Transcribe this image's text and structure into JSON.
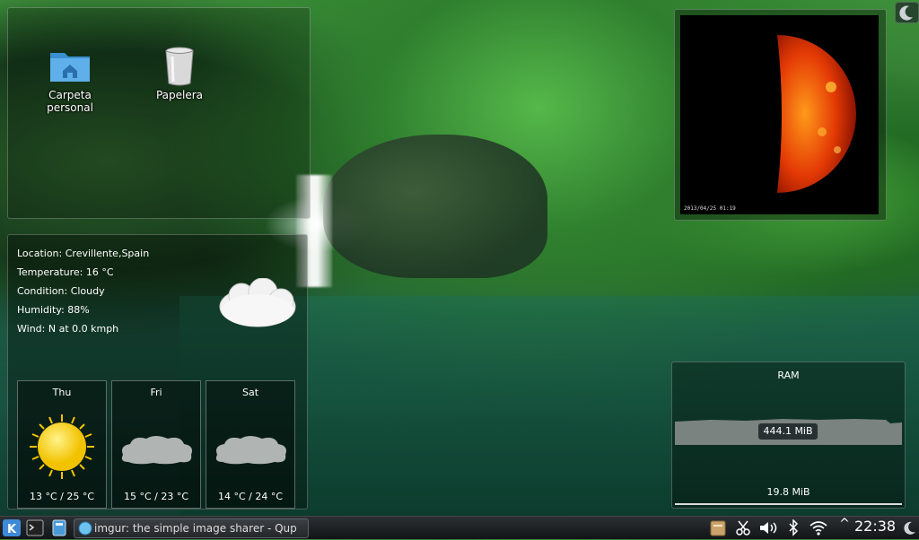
{
  "desktop": {
    "icons": [
      {
        "name": "home-folder",
        "label_line1": "Carpeta",
        "label_line2": "personal"
      },
      {
        "name": "trash",
        "label_line1": "Papelera",
        "label_line2": ""
      }
    ]
  },
  "weather": {
    "location": "Location: Crevillente,Spain",
    "temperature": "Temperature: 16 °C",
    "condition": "Condition: Cloudy",
    "humidity": "Humidity: 88%",
    "wind": "Wind: N at 0.0 kmph",
    "forecast": [
      {
        "day": "Thu",
        "temps": "13 °C / 25 °C",
        "icon": "sun-icon"
      },
      {
        "day": "Fri",
        "temps": "15 °C / 23 °C",
        "icon": "cloud-icon"
      },
      {
        "day": "Sat",
        "temps": "14 °C / 24 °C",
        "icon": "cloud-icon"
      }
    ]
  },
  "sun_frame": {
    "caption": "2013/04/25 01:19"
  },
  "ram": {
    "title": "RAM",
    "used": "444.1 MiB",
    "free": "19.8 MiB"
  },
  "taskbar": {
    "task_title": "imgur: the simple image sharer - Qup",
    "clock": "22:38",
    "tray_arrow": "^"
  },
  "colors": {
    "sun": "#f5d000",
    "solar_disk": "#e03000"
  }
}
